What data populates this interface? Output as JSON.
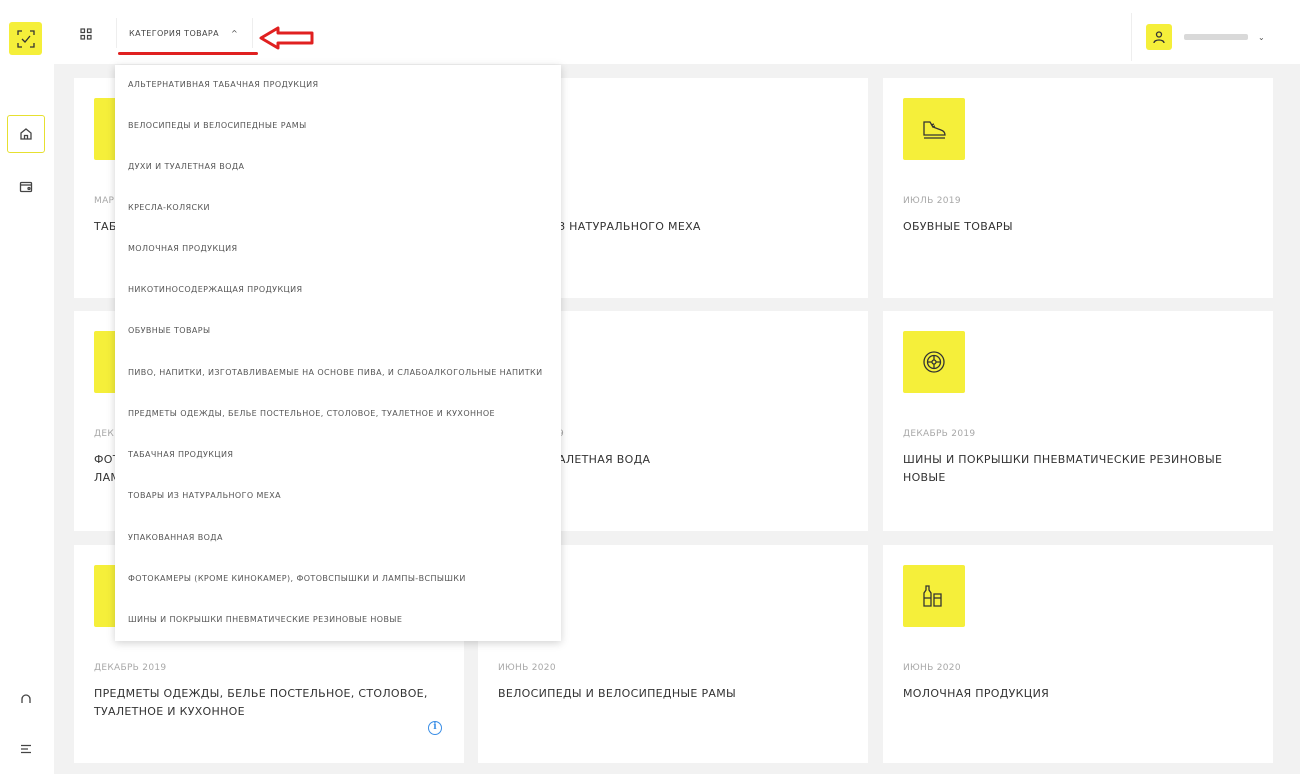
{
  "topbar": {
    "category_label": "КАТЕГОРИЯ ТОВАРА",
    "caret": "^",
    "user_caret": "⌄"
  },
  "dropdown": {
    "items": [
      "АЛЬТЕРНАТИВНАЯ ТАБАЧНАЯ ПРОДУКЦИЯ",
      "ВЕЛОСИПЕДЫ И ВЕЛОСИПЕДНЫЕ РАМЫ",
      "ДУХИ И ТУАЛЕТНАЯ ВОДА",
      "КРЕСЛА-КОЛЯСКИ",
      "МОЛОЧНАЯ ПРОДУКЦИЯ",
      "НИКОТИНОСОДЕРЖАЩАЯ ПРОДУКЦИЯ",
      "ОБУВНЫЕ ТОВАРЫ",
      "ПИВО, НАПИТКИ, ИЗГОТАВЛИВАЕМЫЕ НА ОСНОВЕ ПИВА, И СЛАБОАЛКОГОЛЬНЫЕ НАПИТКИ",
      "ПРЕДМЕТЫ ОДЕЖДЫ, БЕЛЬЕ ПОСТЕЛЬНОЕ, СТОЛОВОЕ, ТУАЛЕТНОЕ И КУХОННОЕ",
      "ТАБАЧНАЯ ПРОДУКЦИЯ",
      "ТОВАРЫ ИЗ НАТУРАЛЬНОГО МЕХА",
      "УПАКОВАННАЯ ВОДА",
      "ФОТОКАМЕРЫ (КРОМЕ КИНОКАМЕР), ФОТОВСПЫШКИ И ЛАМПЫ-ВСПЫШКИ",
      "ШИНЫ И ПОКРЫШКИ ПНЕВМАТИЧЕСКИЕ РЕЗИНОВЫЕ НОВЫЕ"
    ]
  },
  "cards": [
    {
      "date": "МАР",
      "title": "ТАБ",
      "icon": "box-icon"
    },
    {
      "date": "",
      "title": "З НАТУРАЛЬНОГО МЕХА",
      "icon": ""
    },
    {
      "date": "ИЮЛЬ 2019",
      "title": "ОБУВНЫЕ ТОВАРЫ",
      "icon": "shoe-icon"
    },
    {
      "date": "ДЕК",
      "title": "ФОТ ЛАМ",
      "icon": "camera-icon"
    },
    {
      "date": "9",
      "title": "АЛЕТНАЯ ВОДА",
      "icon": ""
    },
    {
      "date": "ДЕКАБРЬ 2019",
      "title": "ШИНЫ И ПОКРЫШКИ ПНЕВМАТИЧЕСКИЕ РЕЗИНОВЫЕ НОВЫЕ",
      "icon": "tire-icon"
    },
    {
      "date": "ДЕКАБРЬ 2019",
      "title": "ПРЕДМЕТЫ ОДЕЖДЫ, БЕЛЬЕ ПОСТЕЛЬНОЕ, СТОЛОВОЕ, ТУАЛЕТНОЕ И КУХОННОЕ",
      "icon": "clothes-icon"
    },
    {
      "date": "ИЮНЬ 2020",
      "title": "ВЕЛОСИПЕДЫ И ВЕЛОСИПЕДНЫЕ РАМЫ",
      "icon": ""
    },
    {
      "date": "ИЮНЬ 2020",
      "title": "МОЛОЧНАЯ ПРОДУКЦИЯ",
      "icon": "milk-icon"
    }
  ],
  "info_glyph": "i",
  "colors": {
    "accent": "#f5ef3a",
    "annotation_red": "#e02020",
    "info_blue": "#3a8ee6"
  }
}
